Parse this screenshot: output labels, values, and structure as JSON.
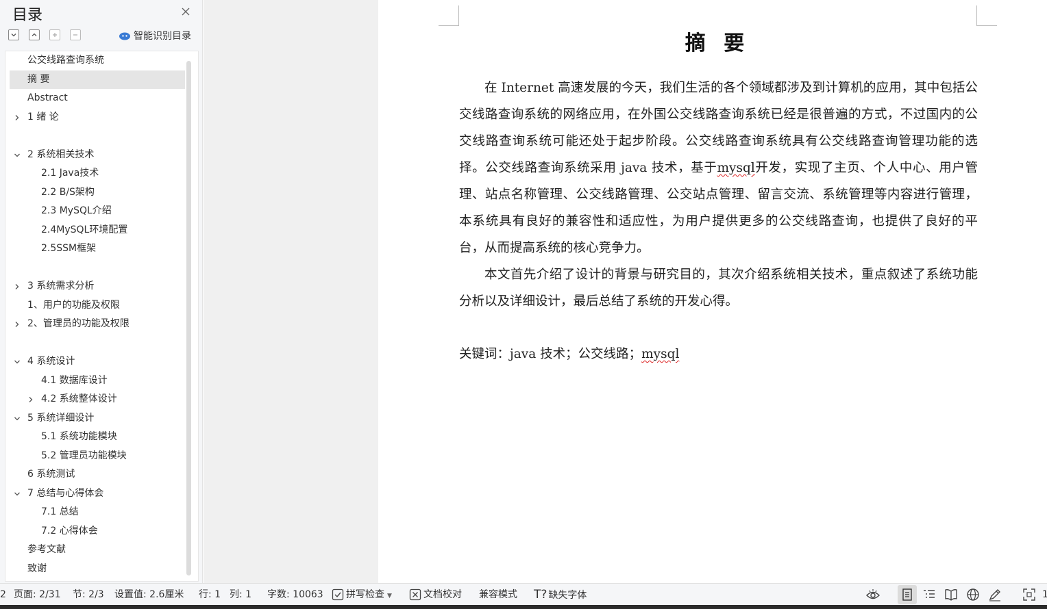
{
  "sidebar": {
    "title": "目录",
    "smart_toc_label": "智能识别目录",
    "toc_items": [
      {
        "label": "公交线路查询系统",
        "level": 0,
        "chevron": "none",
        "selected": false
      },
      {
        "label": "摘  要",
        "level": 0,
        "chevron": "none",
        "selected": true
      },
      {
        "label": "Abstract",
        "level": 0,
        "chevron": "none",
        "selected": false
      },
      {
        "label": "1 绪  论",
        "level": 0,
        "chevron": "right",
        "selected": false
      },
      {
        "label": "",
        "level": 0,
        "chevron": "none",
        "selected": false
      },
      {
        "label": "2 系统相关技术",
        "level": 0,
        "chevron": "down",
        "selected": false
      },
      {
        "label": "2.1 Java技术",
        "level": 1,
        "chevron": "none",
        "selected": false
      },
      {
        "label": "2.2 B/S架构",
        "level": 1,
        "chevron": "none",
        "selected": false
      },
      {
        "label": "2.3 MySQL介绍",
        "level": 1,
        "chevron": "none",
        "selected": false
      },
      {
        "label": "2.4MySQL环境配置",
        "level": 1,
        "chevron": "none",
        "selected": false
      },
      {
        "label": "2.5SSM框架",
        "level": 1,
        "chevron": "none",
        "selected": false
      },
      {
        "label": "",
        "level": 0,
        "chevron": "none",
        "selected": false
      },
      {
        "label": "3 系统需求分析",
        "level": 0,
        "chevron": "right",
        "selected": false
      },
      {
        "label": "1、用户的功能及权限",
        "level": 0,
        "chevron": "none",
        "selected": false
      },
      {
        "label": "2、管理员的功能及权限",
        "level": 0,
        "chevron": "right",
        "selected": false
      },
      {
        "label": "",
        "level": 0,
        "chevron": "none",
        "selected": false
      },
      {
        "label": "4 系统设计",
        "level": 0,
        "chevron": "down",
        "selected": false
      },
      {
        "label": "4.1 数据库设计",
        "level": 1,
        "chevron": "none",
        "selected": false
      },
      {
        "label": "4.2 系统整体设计",
        "level": 1,
        "chevron": "right",
        "selected": false
      },
      {
        "label": "5 系统详细设计",
        "level": 0,
        "chevron": "down",
        "selected": false
      },
      {
        "label": "5.1 系统功能模块",
        "level": 1,
        "chevron": "none",
        "selected": false
      },
      {
        "label": "5.2 管理员功能模块",
        "level": 1,
        "chevron": "none",
        "selected": false
      },
      {
        "label": "6 系统测试",
        "level": 0,
        "chevron": "none",
        "selected": false
      },
      {
        "label": "7 总结与心得体会",
        "level": 0,
        "chevron": "down",
        "selected": false
      },
      {
        "label": "7.1  总结",
        "level": 1,
        "chevron": "none",
        "selected": false
      },
      {
        "label": "7.2  心得体会",
        "level": 1,
        "chevron": "none",
        "selected": false
      },
      {
        "label": "参考文献",
        "level": 0,
        "chevron": "none",
        "selected": false
      },
      {
        "label": "致谢",
        "level": 0,
        "chevron": "none",
        "selected": false
      }
    ]
  },
  "document": {
    "heading": "摘 要",
    "paragraph1_parts": [
      "在 Internet 高速发展的今天，我们生活的各个领域都涉及到计算机的应用，其中包括公交线路查询系统的网络应用，在外国公交线路查询系统已经是很普遍的方式，不过国内的公交线路查询系统可能还处于起步阶段。公交线路查询系统具有公交线路查询管理功能的选择。公交线路查询系统采用 java 技术，基于",
      "mysql",
      "开发，实现了主页、个人中心、用户管理、站点名称管理、公交线路管理、公交站点管理、留言交流、系统管理等内容进行管理，本系统具有良好的兼容性和适应性，为用户提供更多的公交线路查询，也提供了良好的平台，从而提高系统的核心竞争力。"
    ],
    "paragraph2": "本文首先介绍了设计的背景与研究目的，其次介绍系统相关技术，重点叙述了系统功能分析以及详细设计，最后总结了系统的开发心得。",
    "keywords_prefix": "关键词：java 技术；公交线路；",
    "keywords_last": "mysql"
  },
  "statusbar": {
    "edge_left": "2",
    "page": "页面: 2/31",
    "section": "节: 2/3",
    "setting": "设置值: 2.6厘米",
    "row": "行: 1",
    "col": "列: 1",
    "word_count": "字数: 10063",
    "spell_check": "拼写检查",
    "doc_proof": "文档校对",
    "compat_mode": "兼容模式",
    "missing_font": "缺失字体",
    "edge_right": "1"
  },
  "icons": {
    "close": "close-icon",
    "expand_all": "expand-all-icon",
    "collapse_all": "collapse-all-icon",
    "add_level": "plus-icon",
    "remove_level": "minus-icon",
    "smart_toc": "cloud-ai-icon",
    "eye_protect": "eye-icon",
    "view_page": "page-view-icon",
    "view_outline": "outline-view-icon",
    "view_reading": "book-icon",
    "view_web": "globe-icon",
    "view_write": "pen-icon",
    "fullscreen": "fullscreen-icon"
  },
  "colors": {
    "accent": "#3a7bd5",
    "spell_underline": "#d22222"
  }
}
